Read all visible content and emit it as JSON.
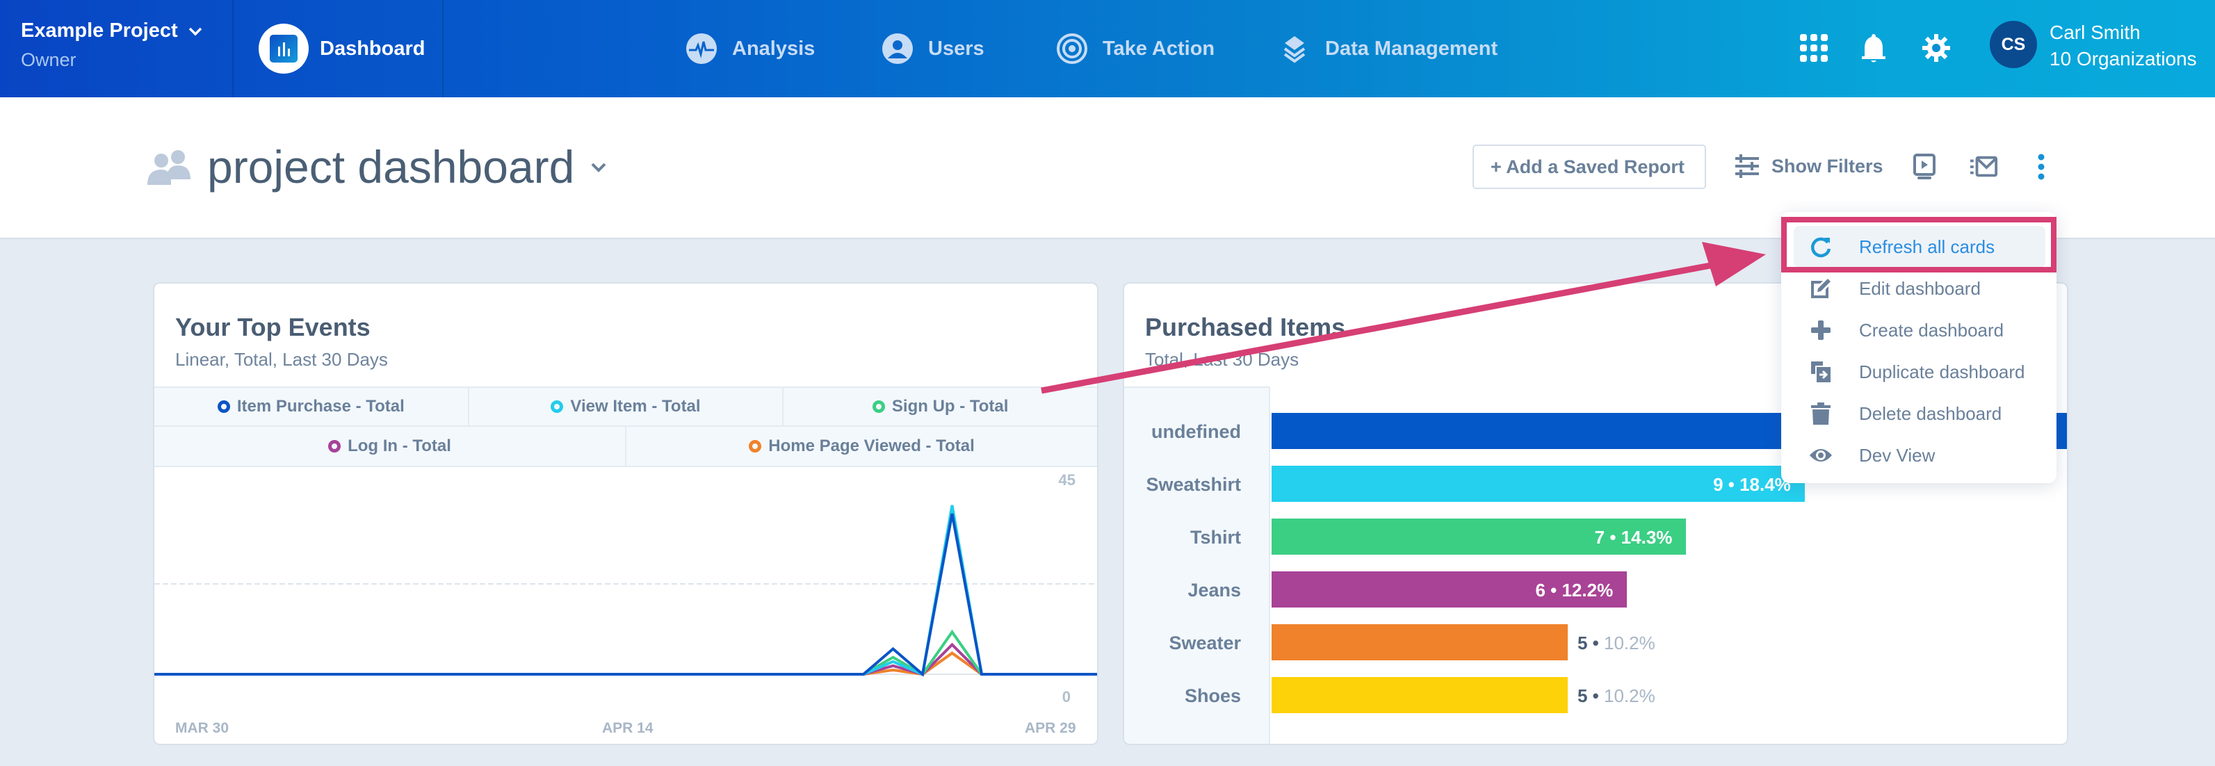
{
  "topnav": {
    "project_name": "Example Project",
    "project_role": "Owner",
    "active_item": "Dashboard",
    "items": [
      {
        "label": "Analysis",
        "icon": "pulse-icon"
      },
      {
        "label": "Users",
        "icon": "user-icon"
      },
      {
        "label": "Take Action",
        "icon": "target-icon"
      },
      {
        "label": "Data Management",
        "icon": "layers-icon"
      }
    ],
    "user_initials": "CS",
    "user_name": "Carl Smith",
    "user_orgs": "10 Organizations"
  },
  "header": {
    "title": "project dashboard",
    "add_report_label": "+ Add a Saved Report",
    "show_filters_label": "Show Filters"
  },
  "menu": {
    "items": [
      {
        "label": "Refresh all cards",
        "icon": "refresh-icon",
        "highlighted": true
      },
      {
        "label": "Edit dashboard",
        "icon": "edit-icon"
      },
      {
        "label": "Create dashboard",
        "icon": "plus-icon"
      },
      {
        "label": "Duplicate dashboard",
        "icon": "duplicate-icon"
      },
      {
        "label": "Delete dashboard",
        "icon": "trash-icon"
      },
      {
        "label": "Dev View",
        "icon": "eye-icon"
      }
    ]
  },
  "annotation": {
    "color": "#d63f74"
  },
  "chart_data": [
    {
      "type": "line",
      "title": "Your Top Events",
      "subtitle": "Linear, Total, Last 30 Days",
      "x_tick_labels": [
        "MAR 30",
        "APR 14",
        "APR 29"
      ],
      "y_tick_labels": [
        "45",
        "0"
      ],
      "ylim": [
        0,
        45
      ],
      "grid": "dashed midline",
      "legend_position": "top",
      "x_count": 31,
      "series": [
        {
          "name": "Item Purchase - Total",
          "color": "#0a55c6",
          "spikes": {
            "25": 6,
            "27": 38
          }
        },
        {
          "name": "View Item - Total",
          "color": "#22cdeb",
          "spikes": {
            "25": 3,
            "27": 40
          }
        },
        {
          "name": "Sign Up - Total",
          "color": "#3bcf84",
          "spikes": {
            "25": 4,
            "27": 10
          }
        },
        {
          "name": "Log In - Total",
          "color": "#a64298",
          "spikes": {
            "25": 2,
            "27": 7
          }
        },
        {
          "name": "Home Page Viewed - Total",
          "color": "#f0822b",
          "spikes": {
            "25": 1,
            "27": 5
          }
        }
      ]
    },
    {
      "type": "bar",
      "orientation": "horizontal",
      "title": "Purchased Items",
      "subtitle": "Total, Last 30 Days",
      "categories": [
        "undefined",
        "Sweatshirt",
        "Tshirt",
        "Jeans",
        "Sweater",
        "Shoes"
      ],
      "values": [
        null,
        9,
        7,
        6,
        5,
        5
      ],
      "percent_labels": [
        "",
        "18.4%",
        "14.3%",
        "12.2%",
        "10.2%",
        "10.2%"
      ],
      "colors": [
        "#0458c8",
        "#24d0ee",
        "#3bcf84",
        "#a84396",
        "#f0822b",
        "#fed208"
      ]
    }
  ]
}
